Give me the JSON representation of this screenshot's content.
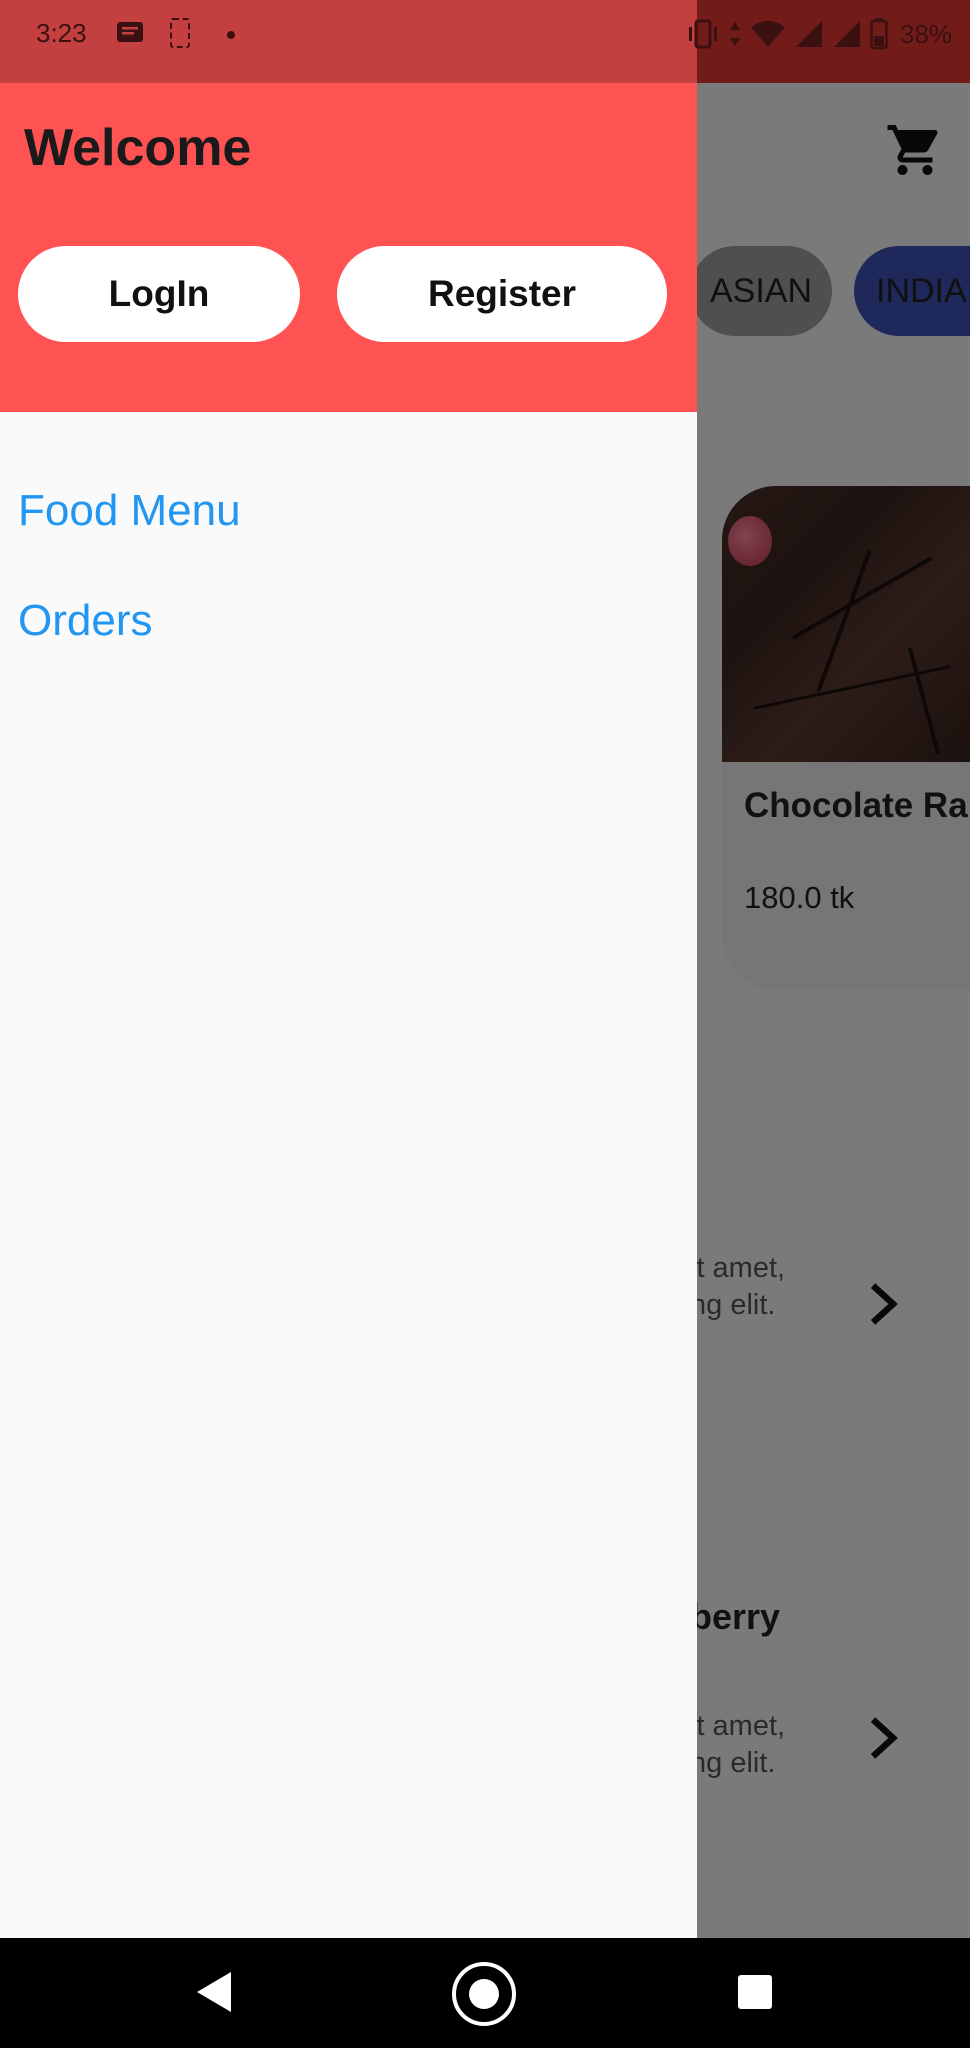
{
  "status_bar": {
    "time": "3:23",
    "battery": "38%"
  },
  "drawer": {
    "title": "Welcome",
    "login_label": "LogIn",
    "register_label": "Register",
    "menu": [
      {
        "label": "Food Menu"
      },
      {
        "label": "Orders"
      }
    ]
  },
  "background": {
    "categories": [
      "ASIAN",
      "INDIA"
    ],
    "featured": {
      "title": "Chocolate Ra",
      "price": "180.0 tk"
    },
    "items": [
      {
        "desc_line1": "it amet,",
        "desc_line2": "ng elit."
      },
      {
        "title": "berry",
        "desc_line1": "it amet,",
        "desc_line2": "ng elit."
      }
    ]
  },
  "icons": {
    "cart": "cart-icon",
    "chevron": "chevron-right-icon",
    "nav": [
      "back-icon",
      "home-icon",
      "recent-apps-icon"
    ]
  },
  "colors": {
    "drawer_header": "#ff5252",
    "status_bar": "#c44040",
    "menu_link": "#2196f3",
    "chip_indian": "#3f51b5"
  }
}
